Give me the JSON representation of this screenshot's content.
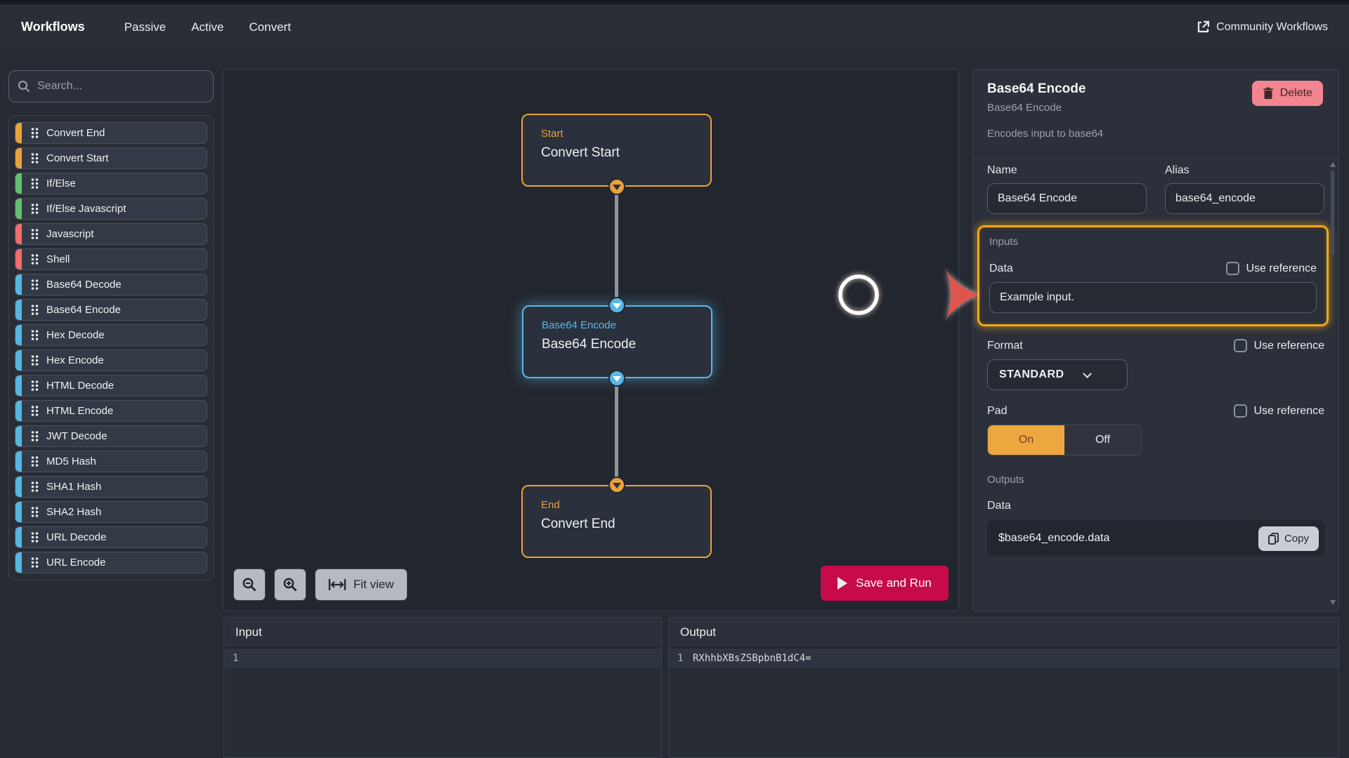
{
  "nav": {
    "brand": "Workflows",
    "passive": "Passive",
    "active": "Active",
    "convert": "Convert",
    "community": "Community Workflows"
  },
  "sidebar": {
    "search_placeholder": "Search...",
    "items": [
      {
        "label": "Convert End",
        "color": "#e9a23b"
      },
      {
        "label": "Convert Start",
        "color": "#e9a23b"
      },
      {
        "label": "If/Else",
        "color": "#63c06e"
      },
      {
        "label": "If/Else Javascript",
        "color": "#63c06e"
      },
      {
        "label": "Javascript",
        "color": "#f16c6c"
      },
      {
        "label": "Shell",
        "color": "#f16c6c"
      },
      {
        "label": "Base64 Decode",
        "color": "#56b8e0"
      },
      {
        "label": "Base64 Encode",
        "color": "#56b8e0"
      },
      {
        "label": "Hex Decode",
        "color": "#56b8e0"
      },
      {
        "label": "Hex Encode",
        "color": "#56b8e0"
      },
      {
        "label": "HTML Decode",
        "color": "#56b8e0"
      },
      {
        "label": "HTML Encode",
        "color": "#56b8e0"
      },
      {
        "label": "JWT Decode",
        "color": "#56b8e0"
      },
      {
        "label": "MD5 Hash",
        "color": "#56b8e0"
      },
      {
        "label": "SHA1 Hash",
        "color": "#56b8e0"
      },
      {
        "label": "SHA2 Hash",
        "color": "#56b8e0"
      },
      {
        "label": "URL Decode",
        "color": "#56b8e0"
      },
      {
        "label": "URL Encode",
        "color": "#56b8e0"
      }
    ]
  },
  "canvas": {
    "nodes": [
      {
        "kind": "Start",
        "name": "Convert Start"
      },
      {
        "kind": "Base64 Encode",
        "name": "Base64 Encode"
      },
      {
        "kind": "End",
        "name": "Convert End"
      }
    ],
    "toolbar": {
      "fit_view": "Fit view"
    },
    "save_and_run": "Save and Run"
  },
  "inspector": {
    "title": "Base64 Encode",
    "subtitle": "Base64 Encode",
    "description": "Encodes input to base64",
    "delete_label": "Delete",
    "name_label": "Name",
    "name_value": "Base64 Encode",
    "alias_label": "Alias",
    "alias_value": "base64_encode",
    "inputs_label": "Inputs",
    "data_label": "Data",
    "use_reference_label": "Use reference",
    "data_value": "Example input.",
    "format_label": "Format",
    "format_value": "STANDARD",
    "pad_label": "Pad",
    "pad_on": "On",
    "pad_off": "Off",
    "outputs_label": "Outputs",
    "output_data_label": "Data",
    "output_value": "$base64_encode.data",
    "copy_label": "Copy"
  },
  "bottom": {
    "input_title": "Input",
    "output_title": "Output",
    "input_line_number": "1",
    "output_line_number": "1",
    "output_line_text": "RXhhbXBsZSBpbnB1dC4="
  },
  "colors": {
    "accent_orange": "#e9a23b",
    "accent_blue": "#59b7e8",
    "accent_green": "#63c06e",
    "accent_red": "#f16c6c",
    "delete_pink": "#f2858f",
    "run_crimson": "#c70b4a",
    "highlight_orange": "#f2a71b"
  }
}
